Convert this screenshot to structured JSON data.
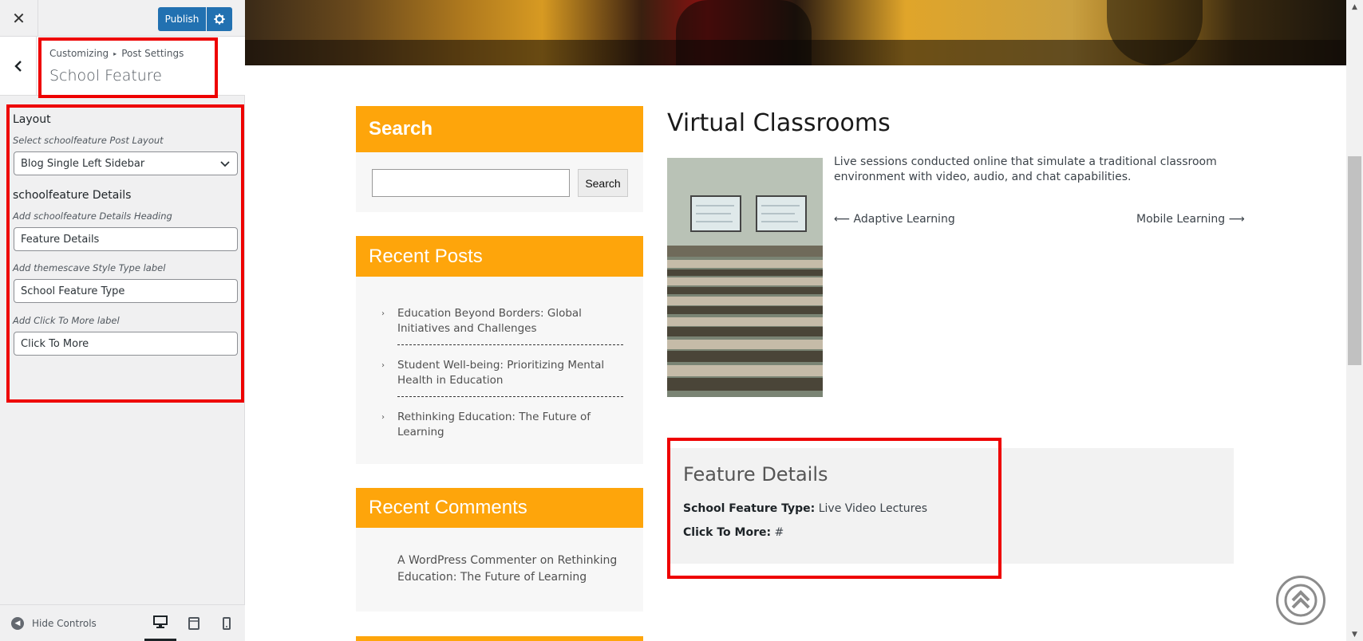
{
  "topbar": {
    "close_glyph": "✕",
    "publish_label": "Publish"
  },
  "section": {
    "breadcrumb_root": "Customizing",
    "breadcrumb_parent": "Post Settings",
    "title": "School Feature"
  },
  "controls": {
    "layout_title": "Layout",
    "layout_desc": "Select schoolfeature Post Layout",
    "layout_value": "Blog Single Left Sidebar",
    "details_title": "schoolfeature Details",
    "heading_desc": "Add schoolfeature Details Heading",
    "heading_value": "Feature Details",
    "type_desc": "Add themescave Style Type label",
    "type_value": "School Feature Type",
    "more_desc": "Add Click To More label",
    "more_value": "Click To More"
  },
  "bottombar": {
    "hide_controls_label": "Hide Controls"
  },
  "widgets": {
    "search_title": "Search",
    "search_button": "Search",
    "recent_posts_title": "Recent Posts",
    "recent_posts": [
      "Education Beyond Borders: Global Initiatives and Challenges",
      "Student Well-being: Prioritizing Mental Health in Education",
      "Rethinking Education: The Future of Learning"
    ],
    "recent_comments_title": "Recent Comments",
    "comment_author": "A WordPress Commenter",
    "comment_on": "on",
    "comment_post": "Rethinking Education: The Future of Learning"
  },
  "post": {
    "title": "Virtual Classrooms",
    "excerpt": "Live sessions conducted online that simulate a traditional classroom environment with video, audio, and chat capabilities.",
    "prev_link": "⟵ Adaptive Learning",
    "next_link": "Mobile Learning ⟶",
    "details_heading": "Feature Details",
    "type_label": "School Feature Type:",
    "type_value": "Live Video Lectures",
    "more_label": "Click To More:",
    "more_value": "#"
  },
  "colors": {
    "accent": "#fea50b",
    "publish_blue": "#2271b1",
    "highlight_red": "#ee0000"
  },
  "icons": [
    "close-icon",
    "gear-icon",
    "chevron-left-icon",
    "chevron-down-icon",
    "hide-controls-icon",
    "desktop-icon",
    "tablet-icon",
    "mobile-icon",
    "back-to-top-icon"
  ]
}
